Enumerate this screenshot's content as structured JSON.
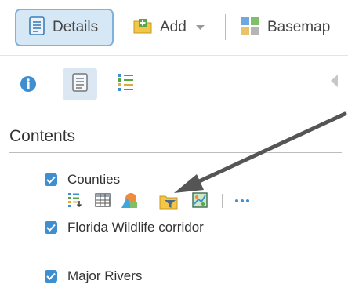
{
  "toolbar": {
    "details_label": "Details",
    "add_label": "Add",
    "basemap_label": "Basemap"
  },
  "tabs": {
    "about_icon": "info-icon",
    "content_icon": "content-list-icon",
    "legend_icon": "legend-icon",
    "active": "content"
  },
  "contents": {
    "title": "Contents",
    "layers": [
      {
        "name": "Counties",
        "checked": true,
        "expanded": true
      },
      {
        "name": "Florida Wildlife corridor",
        "checked": true
      },
      {
        "name": "Major Rivers",
        "checked": true
      }
    ],
    "layer_tools": [
      "show-legend-icon",
      "show-table-icon",
      "change-style-icon",
      "filter-icon",
      "perform-analysis-icon",
      "more-options-icon"
    ]
  },
  "colors": {
    "accent": "#3d8fd1",
    "active_button_bg": "#d6e8f6",
    "active_button_border": "#7fb2dc",
    "annotation_arrow": "#555555"
  }
}
